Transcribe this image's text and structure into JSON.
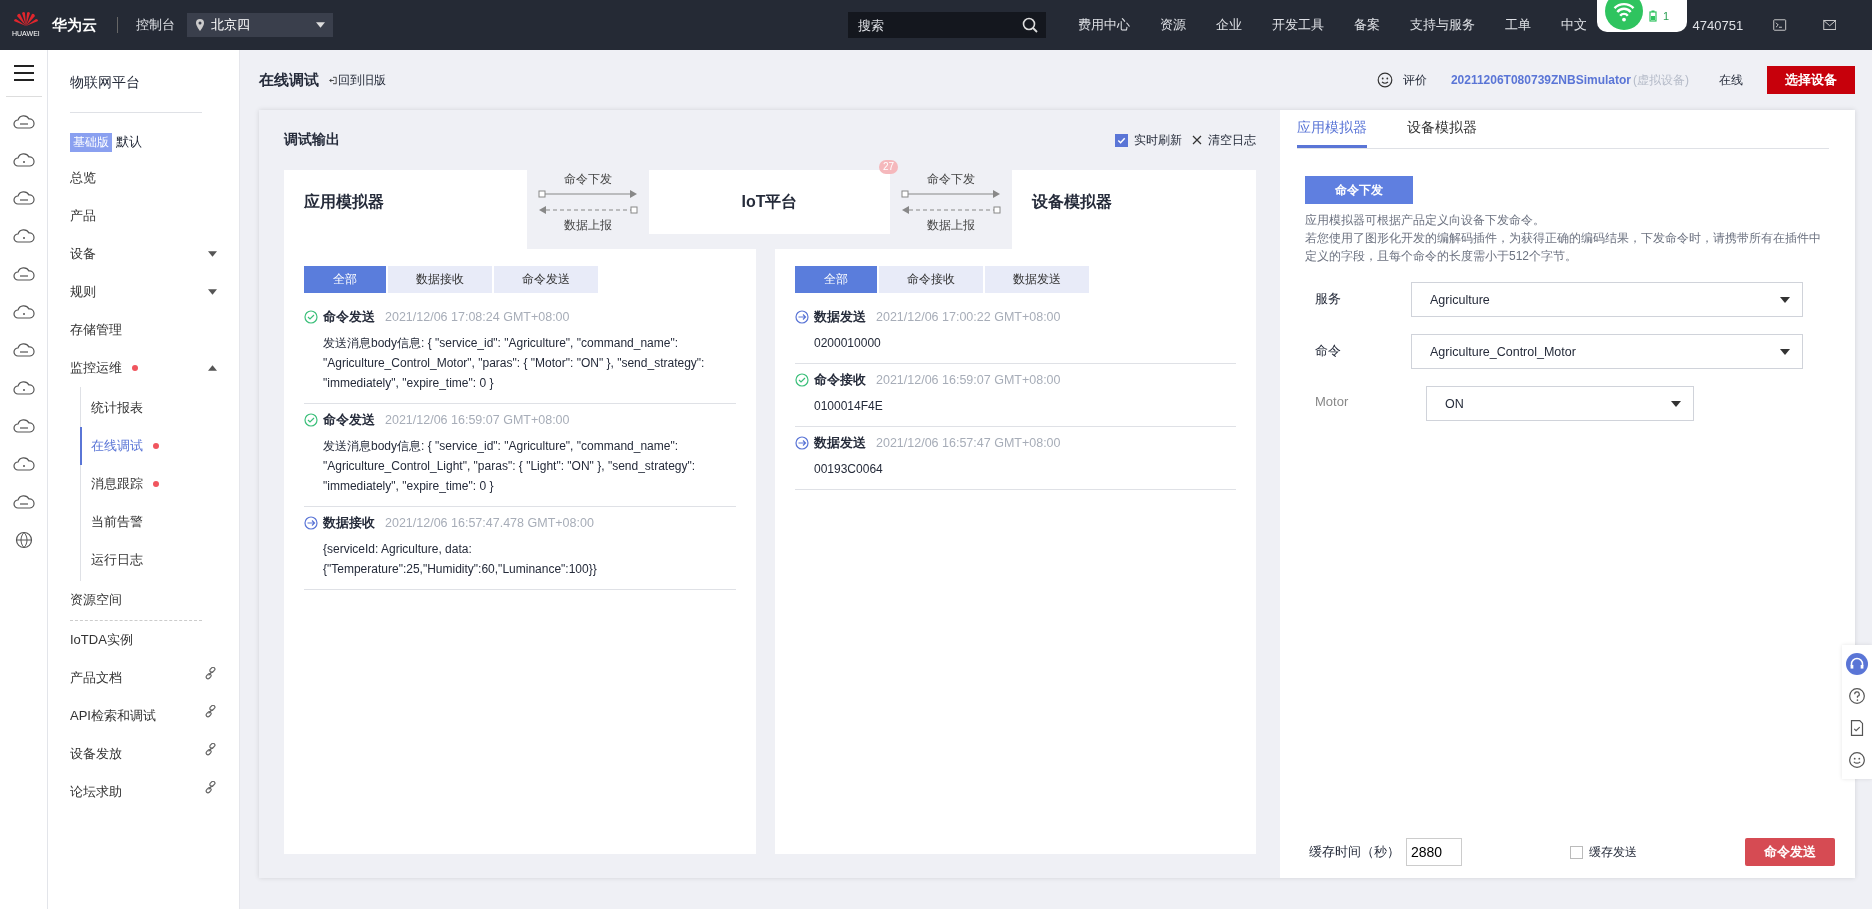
{
  "top_bar": {
    "brand": "华为云",
    "brand_sub": "HUAWEI",
    "console": "控制台",
    "region": "北京四",
    "search": {
      "placeholder": "搜索"
    },
    "nav": [
      "费用中心",
      "资源",
      "企业",
      "开发工具",
      "备案",
      "支持与服务",
      "工单",
      "中文"
    ],
    "account": "4740751"
  },
  "popup": {
    "count": "1"
  },
  "sidebar": {
    "title": "物联网平台",
    "edition": {
      "tag": "基础版",
      "name": "默认"
    },
    "groups": [
      {
        "items": [
          {
            "label": "总览",
            "kind": "plain",
            "selected": false
          },
          {
            "label": "产品",
            "kind": "plain",
            "selected": false
          },
          {
            "label": "设备",
            "kind": "expandable",
            "expanded": false,
            "selected": false
          },
          {
            "label": "规则",
            "kind": "expandable",
            "expanded": false,
            "selected": false
          },
          {
            "label": "存储管理",
            "kind": "plain",
            "selected": false
          },
          {
            "label": "监控运维",
            "kind": "expandable",
            "expanded": true,
            "dot": true,
            "selected": false,
            "children": [
              {
                "label": "统计报表",
                "selected": false,
                "dot": false
              },
              {
                "label": "在线调试",
                "selected": true,
                "dot": true
              },
              {
                "label": "消息跟踪",
                "selected": false,
                "dot": true
              },
              {
                "label": "当前告警",
                "selected": false,
                "dot": false
              },
              {
                "label": "运行日志",
                "selected": false,
                "dot": false
              }
            ]
          },
          {
            "label": "资源空间",
            "kind": "plain",
            "selected": false
          }
        ]
      },
      {
        "items": [
          {
            "label": "IoTDA实例",
            "kind": "plain",
            "selected": false
          },
          {
            "label": "产品文档",
            "kind": "link",
            "selected": false
          },
          {
            "label": "API检索和调试",
            "kind": "link",
            "selected": false
          },
          {
            "label": "设备发放",
            "kind": "link",
            "selected": false
          },
          {
            "label": "论坛求助",
            "kind": "link",
            "selected": false
          }
        ]
      }
    ]
  },
  "header": {
    "title": "在线调试",
    "back_link": "回到旧版",
    "rate": "评价",
    "device": "20211206T080739ZNBSimulator",
    "device_tag": "(虚拟设备)",
    "status": "在线",
    "select_button": "选择设备"
  },
  "debug": {
    "title": "调试输出",
    "realtime": {
      "label": "实时刷新",
      "checked": true
    },
    "clear": "清空日志",
    "diagram": {
      "left": "应用模拟器",
      "center": "IoT平台",
      "right": "设备模拟器",
      "badge": "27",
      "links": [
        {
          "down": "命令下发",
          "up": "数据上报"
        },
        {
          "down": "命令下发",
          "up": "数据上报"
        }
      ]
    },
    "panels": [
      {
        "tabs": [
          {
            "label": "全部",
            "selected": true
          },
          {
            "label": "数据接收",
            "selected": false
          },
          {
            "label": "命令发送",
            "selected": false
          }
        ],
        "entries": [
          {
            "kind": "ok",
            "title": "命令发送",
            "time": "2021/12/06 17:08:24 GMT+08:00",
            "body": "发送消息body信息: { \"service_id\": \"Agriculture\", \"command_name\": \"Agriculture_Control_Motor\", \"paras\": { \"Motor\": \"ON\" }, \"send_strategy\": \"immediately\", \"expire_time\": 0 }"
          },
          {
            "kind": "ok",
            "title": "命令发送",
            "time": "2021/12/06 16:59:07 GMT+08:00",
            "body": "发送消息body信息: { \"service_id\": \"Agriculture\", \"command_name\": \"Agriculture_Control_Light\", \"paras\": { \"Light\": \"ON\" }, \"send_strategy\": \"immediately\", \"expire_time\": 0 }"
          },
          {
            "kind": "data",
            "title": "数据接收",
            "time": "2021/12/06 16:57:47.478 GMT+08:00",
            "body": "{serviceId: Agriculture, data: {\"Temperature\":25,\"Humidity\":60,\"Luminance\":100}}"
          }
        ]
      },
      {
        "tabs": [
          {
            "label": "全部",
            "selected": true
          },
          {
            "label": "命令接收",
            "selected": false
          },
          {
            "label": "数据发送",
            "selected": false
          }
        ],
        "entries": [
          {
            "kind": "data",
            "title": "数据发送",
            "time": "2021/12/06 17:00:22 GMT+08:00",
            "body": "0200010000"
          },
          {
            "kind": "ok",
            "title": "命令接收",
            "time": "2021/12/06 16:59:07 GMT+08:00",
            "body": "0100014F4E"
          },
          {
            "kind": "data",
            "title": "数据发送",
            "time": "2021/12/06 16:57:47 GMT+08:00",
            "body": "00193C0064"
          }
        ]
      }
    ]
  },
  "simulator": {
    "tabs": [
      {
        "label": "应用模拟器",
        "selected": true
      },
      {
        "label": "设备模拟器",
        "selected": false
      }
    ],
    "send_button": "命令下发",
    "description": [
      "应用模拟器可根据产品定义向设备下发命令。",
      "若您使用了图形化开发的编解码插件，为获得正确的编码结果，下发命令时，请携带所有在插件中定义的字段，且每个命令的长度需小于512个字节。"
    ],
    "fields": [
      {
        "kind": "main",
        "label": "服务",
        "value": "Agriculture"
      },
      {
        "kind": "main",
        "label": "命令",
        "value": "Agriculture_Control_Motor"
      },
      {
        "kind": "parameter",
        "label": "Motor",
        "value": "ON"
      }
    ],
    "cache_time": {
      "label": "缓存时间（秒）",
      "value": "2880"
    },
    "cache_send": {
      "label": "缓存发送",
      "checked": false
    },
    "submit": "命令发送"
  }
}
